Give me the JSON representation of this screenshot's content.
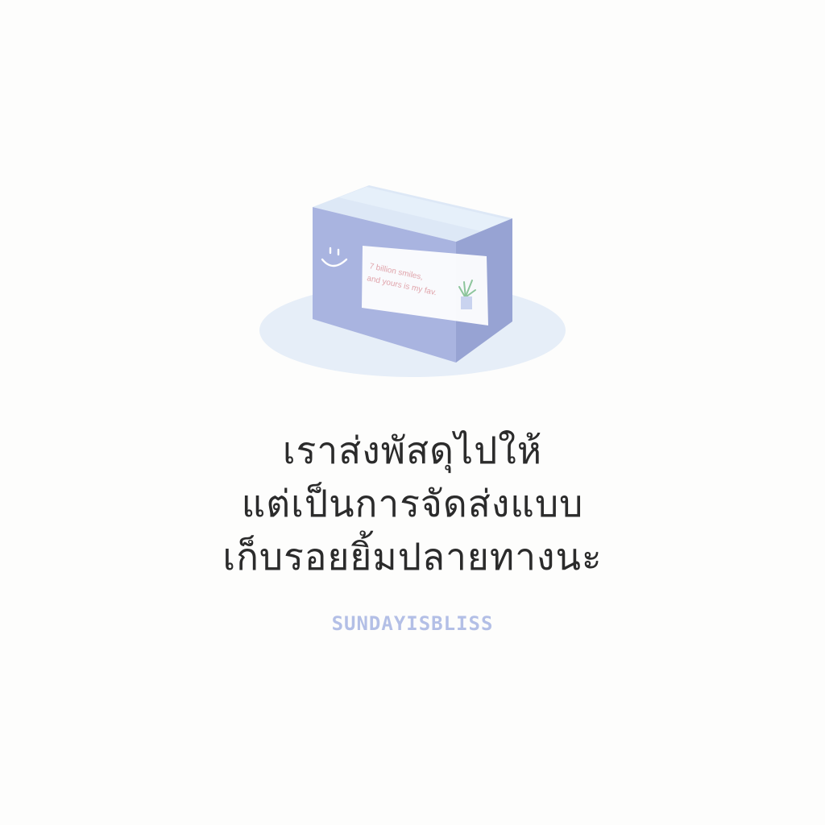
{
  "illustration": {
    "subject": "parcel-box",
    "label_text_line1": "7 billion smiles,",
    "label_text_line2": "and yours is my fav.",
    "colors": {
      "shadow": "#e6eef8",
      "box_front": "#a9b4e0",
      "box_side": "#97a3d3",
      "box_top": "#dde8f6",
      "label": "#ffffff",
      "label_text": "#e0a4ab",
      "smiley": "#ffffff",
      "plant": "#8dc59c"
    }
  },
  "quote": {
    "lines": [
      "เราส่งพัสดุไปให้",
      "แต่เป็นการจัดส่งแบบ",
      "เก็บรอยยิ้มปลายทางนะ"
    ],
    "color": "#2b2b2b"
  },
  "signature": {
    "text": "SUNDAYISBLISS",
    "color": "#b3bfe6"
  }
}
